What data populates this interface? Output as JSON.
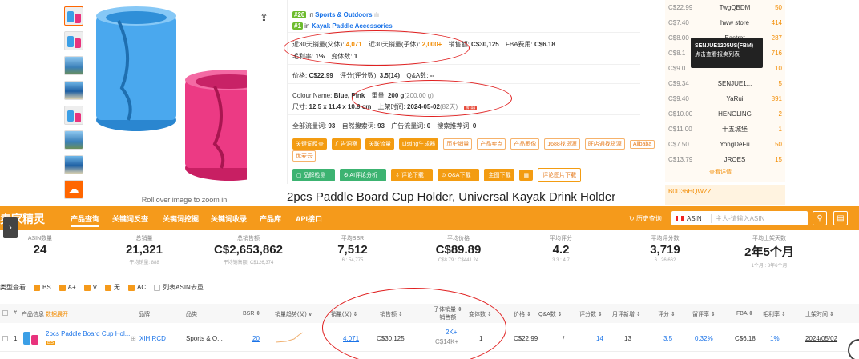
{
  "product": {
    "zoom_hint": "Roll over image to zoom in",
    "title": "2pcs Paddle Board Cup Holder, Universal Kayak Drink Holder",
    "rank1_num": "#20",
    "rank1_in": "in",
    "rank1_cat": "Sports & Outdoors",
    "rank2_num": "#1",
    "rank2_in": "in",
    "rank2_cat": "Kayak Paddle Accessories"
  },
  "metrics": {
    "sales30_parent_label": "近30天销量(父体):",
    "sales30_parent": "4,071",
    "sales30_child_label": "近30天销量(子体):",
    "sales30_child": "2,000+",
    "revenue_label": "销售额:",
    "revenue": "C$30,125",
    "fba_label": "FBA费用:",
    "fba": "C$6.18",
    "margin_label": "毛利率:",
    "margin": "1%",
    "variants_label": "变体数:",
    "variants": "1",
    "price_label": "价格:",
    "price": "C$22.99",
    "rating_label": "评分(评分数):",
    "rating": "3.5(14)",
    "qa_label": "Q&A数:",
    "qa": "--",
    "colour_label": "Colour Name:",
    "colour": "Blue, Pink",
    "weight_label": "重量:",
    "weight": "200 g",
    "weight_paren": "(200.00 g)",
    "size_label": "尺寸:",
    "size": "12.5 x 11.4 x 10.9 cm",
    "launch_label": "上架时间:",
    "launch": "2024-05-02",
    "launch_days": "(82天)",
    "new_badge": "新品",
    "traffic_all_label": "全部流量词:",
    "traffic_all": "93",
    "natural_label": "自然搜索词:",
    "natural": "93",
    "ad_label": "广告流量词:",
    "ad": "0",
    "recommend_label": "搜索推荐词:",
    "recommend": "0"
  },
  "tags": [
    "关键词反查",
    "广告洞察",
    "关联流量",
    "Listing生成器",
    "历史销量",
    "产品卖点",
    "产品画像",
    "1688找货源",
    "旺店通找货源",
    "Alibaba",
    "优麦云"
  ],
  "actions": {
    "brand": "品牌检测",
    "ai": "AI评论分析",
    "review_dl": "评论下载",
    "qa_dl": "Q&A下载",
    "main_dl": "主图下载",
    "review_img_dl": "评论图片下载"
  },
  "sellers": [
    {
      "price": "C$22.99",
      "name": "TwgQBDM",
      "count": "50"
    },
    {
      "price": "C$7.40",
      "name": "hww store",
      "count": "414"
    },
    {
      "price": "C$8.00",
      "name": "Eastrat",
      "count": "287"
    },
    {
      "price": "C$8.1",
      "name": "",
      "count": "716"
    },
    {
      "price": "C$9.0",
      "name": "",
      "count": "10"
    },
    {
      "price": "C$9.34",
      "name": "SENJUE1...",
      "count": "5"
    },
    {
      "price": "C$9.40",
      "name": "YaRui",
      "count": "891"
    },
    {
      "price": "C$10.00",
      "name": "HENGLING",
      "count": "2"
    },
    {
      "price": "C$11.00",
      "name": "十五城堡",
      "count": "1"
    },
    {
      "price": "C$7.50",
      "name": "YongDeFu",
      "count": "50"
    },
    {
      "price": "C$13.79",
      "name": "JROES",
      "count": "15"
    }
  ],
  "tooltip": {
    "line1": "SENJUE1205US(FBM)",
    "line2": "点击查看报卖列表"
  },
  "seller_more": "查看详情",
  "asin_box": "B0D36HQWZZ",
  "nav": {
    "logo": "卖家精灵",
    "items": [
      "产品查询",
      "关键词反查",
      "关键词挖掘",
      "关键词收录",
      "产品库",
      "API接口"
    ],
    "history": "历史查询",
    "asin": "ASIN",
    "placeholder": "主人-请输入ASIN"
  },
  "stats": [
    {
      "label": "ASIN数量",
      "value": "24",
      "sub": ""
    },
    {
      "label": "总销量",
      "value": "21,321",
      "sub": "平均销量: 888"
    },
    {
      "label": "总销售额",
      "value": "C$2,653,862",
      "sub": "平均销售额: C$126,374"
    },
    {
      "label": "平均BSR",
      "value": "7,512",
      "sub": "6 : 54,775"
    },
    {
      "label": "平均价格",
      "value": "C$89.89",
      "sub": "C$8.79 : C$441.24"
    },
    {
      "label": "平均评分",
      "value": "4.2",
      "sub": "3.3 : 4.7"
    },
    {
      "label": "平均评分数",
      "value": "3,719",
      "sub": "6 : 26,662"
    },
    {
      "label": "平均上架天数",
      "value": "2年5个月",
      "sub": "1个月 : 8年6个月"
    }
  ],
  "filters": {
    "lead": "类型查看",
    "items": [
      "BS",
      "A+",
      "V",
      "无",
      "AC"
    ],
    "dedupe": "列表ASIN去重"
  },
  "table": {
    "headers": [
      "#",
      "产品信息",
      "数据展开",
      "品牌",
      "品类",
      "BSR",
      "销量趋势(父)",
      "销量(父)",
      "销售额",
      "子体销量",
      "销售额",
      "变体数",
      "价格",
      "Q&A数",
      "评分数",
      "月评新增",
      "评分",
      "留评率",
      "FBA",
      "毛利率",
      "上架时间"
    ],
    "row": {
      "idx": "1",
      "title": "2pcs Paddle Board Cup Hol...",
      "badge": "BS",
      "brand": "XIHIRCD",
      "cat": "Sports & O...",
      "bsr": "20",
      "sales": "4,071",
      "revenue": "C$30,125",
      "child_sales": "2K+",
      "child_rev": "C$14K+",
      "variants": "1",
      "price": "C$22.99",
      "qa": "/",
      "rating_count": "14",
      "monthly_new": "13",
      "rating": "3.5",
      "review_rate": "0.32%",
      "fba": "C$6.18",
      "margin": "1%",
      "launch": "2024/05/02"
    }
  }
}
